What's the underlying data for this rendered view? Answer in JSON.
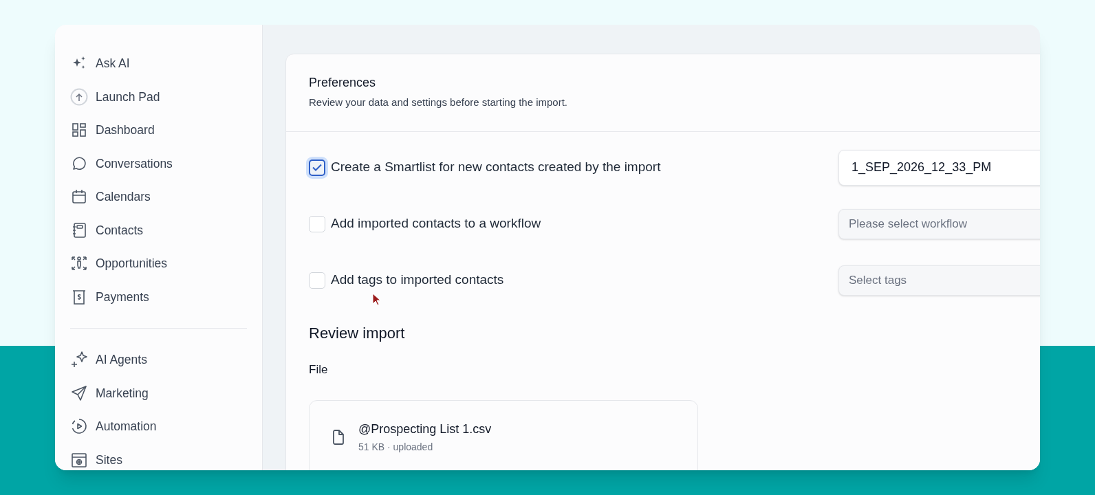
{
  "sidebar": {
    "groups": [
      {
        "items": [
          {
            "label": "Ask AI"
          },
          {
            "label": "Launch Pad"
          },
          {
            "label": "Dashboard"
          },
          {
            "label": "Conversations"
          },
          {
            "label": "Calendars"
          },
          {
            "label": "Contacts"
          },
          {
            "label": "Opportunities"
          },
          {
            "label": "Payments"
          }
        ]
      },
      {
        "items": [
          {
            "label": "AI Agents"
          },
          {
            "label": "Marketing"
          },
          {
            "label": "Automation"
          },
          {
            "label": "Sites"
          }
        ]
      }
    ]
  },
  "preferences": {
    "title": "Preferences",
    "subtitle": "Review your data and settings before starting the import.",
    "options": [
      {
        "label": "Create a Smartlist for new contacts created by the import",
        "checked": true,
        "field": {
          "value": "1_SEP_2026_12_33_PM"
        }
      },
      {
        "label": "Add imported contacts to a workflow",
        "checked": false,
        "field": {
          "placeholder": "Please select workflow"
        }
      },
      {
        "label": "Add tags to imported contacts",
        "checked": false,
        "field": {
          "placeholder": "Select tags"
        }
      }
    ]
  },
  "review": {
    "title": "Review import",
    "file_heading": "File",
    "file": {
      "name": "@Prospecting List 1.csv",
      "meta": "51 KB · uploaded"
    }
  }
}
